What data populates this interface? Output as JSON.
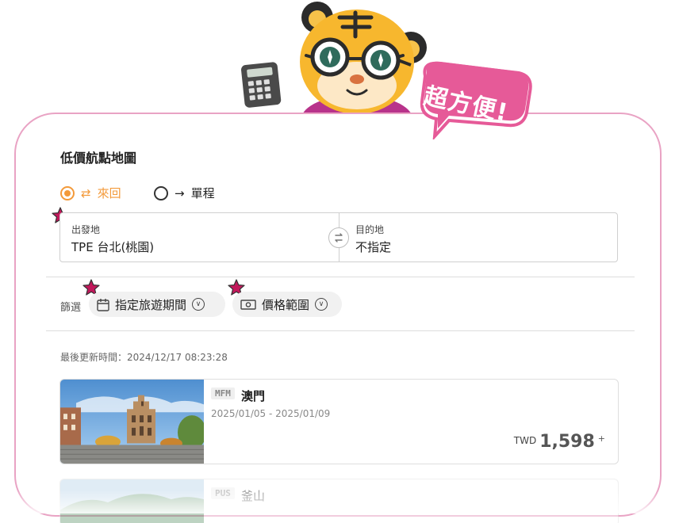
{
  "promo": {
    "bubble_text": "超方便!"
  },
  "panel": {
    "title": "低價航點地圖"
  },
  "trip_type": {
    "options": [
      {
        "arrow": "⇄",
        "label": "來回",
        "selected": true
      },
      {
        "arrow": "→",
        "label": "單程",
        "selected": false
      }
    ]
  },
  "route": {
    "origin": {
      "label": "出發地",
      "value": "TPE 台北(桃園)"
    },
    "destination": {
      "label": "目的地",
      "value": "不指定"
    },
    "swap_icon": "swap-icon"
  },
  "filters": {
    "label": "篩選",
    "date_chip": {
      "label": "指定旅遊期間",
      "icon": "calendar-icon"
    },
    "price_chip": {
      "label": "價格範圍",
      "icon": "cash-icon"
    }
  },
  "last_updated": "最後更新時間：2024/12/17 08:23:28",
  "results": [
    {
      "code": "MFM",
      "city": "澳門",
      "dates": "2025/01/05 - 2025/01/09",
      "currency": "TWD",
      "price": "1,598",
      "suffix": "+"
    },
    {
      "code": "PUS",
      "city": "釜山"
    }
  ],
  "colors": {
    "accent": "#f39a3a",
    "frame": "#e9a3c4",
    "bubble": "#e65a98",
    "star": "#c2185b"
  }
}
